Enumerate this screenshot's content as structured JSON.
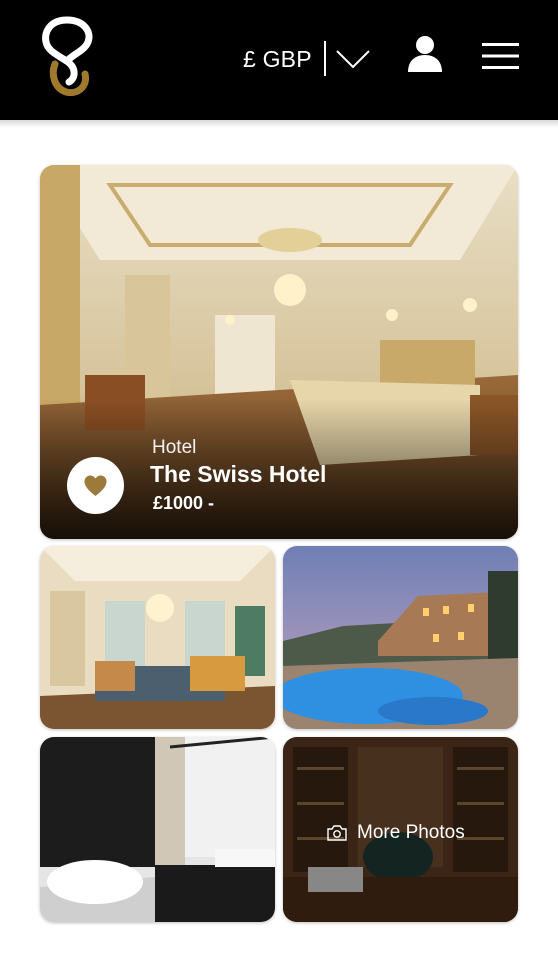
{
  "header": {
    "logo_icon": "brand-logo-icon",
    "currency_label": "£ GBP",
    "currency_dropdown_icon": "chevron-down-icon",
    "account_icon": "user-icon",
    "menu_icon": "hamburger-menu-icon",
    "background_color": "#000000",
    "accent_color": "#a07a2c"
  },
  "listing": {
    "type": "Hotel",
    "name": "The Swiss Hotel",
    "price": "£1000 -",
    "favorite_icon": "heart-icon",
    "favorite_color": "#9b7a3a"
  },
  "gallery": {
    "photos": [
      {
        "name": "bedroom-photo"
      },
      {
        "name": "lounge-photo"
      },
      {
        "name": "pool-villa-photo"
      },
      {
        "name": "bathroom-photo"
      },
      {
        "name": "library-photo"
      }
    ],
    "more_photos_label": "More Photos",
    "more_photos_icon": "camera-icon"
  }
}
